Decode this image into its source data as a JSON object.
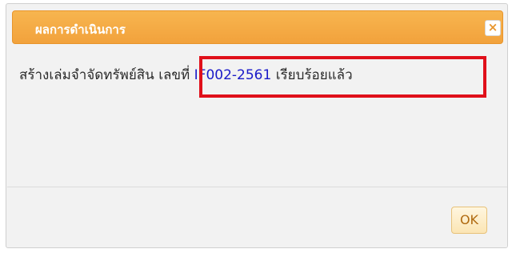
{
  "dialog": {
    "title": "ผลการดำเนินการ",
    "close_icon": "close-icon",
    "close_glyph": "×",
    "message_prefix": "สร้างเล่มจำจัดทรัพย์สิน เลขที่ ",
    "document_number": "IF002-2561",
    "message_suffix": " เรียบร้อยแล้ว",
    "ok_label": "OK"
  },
  "colors": {
    "titlebar": "#f2a23c",
    "document_number": "#1a1ac8",
    "highlight": "#e0101a"
  }
}
